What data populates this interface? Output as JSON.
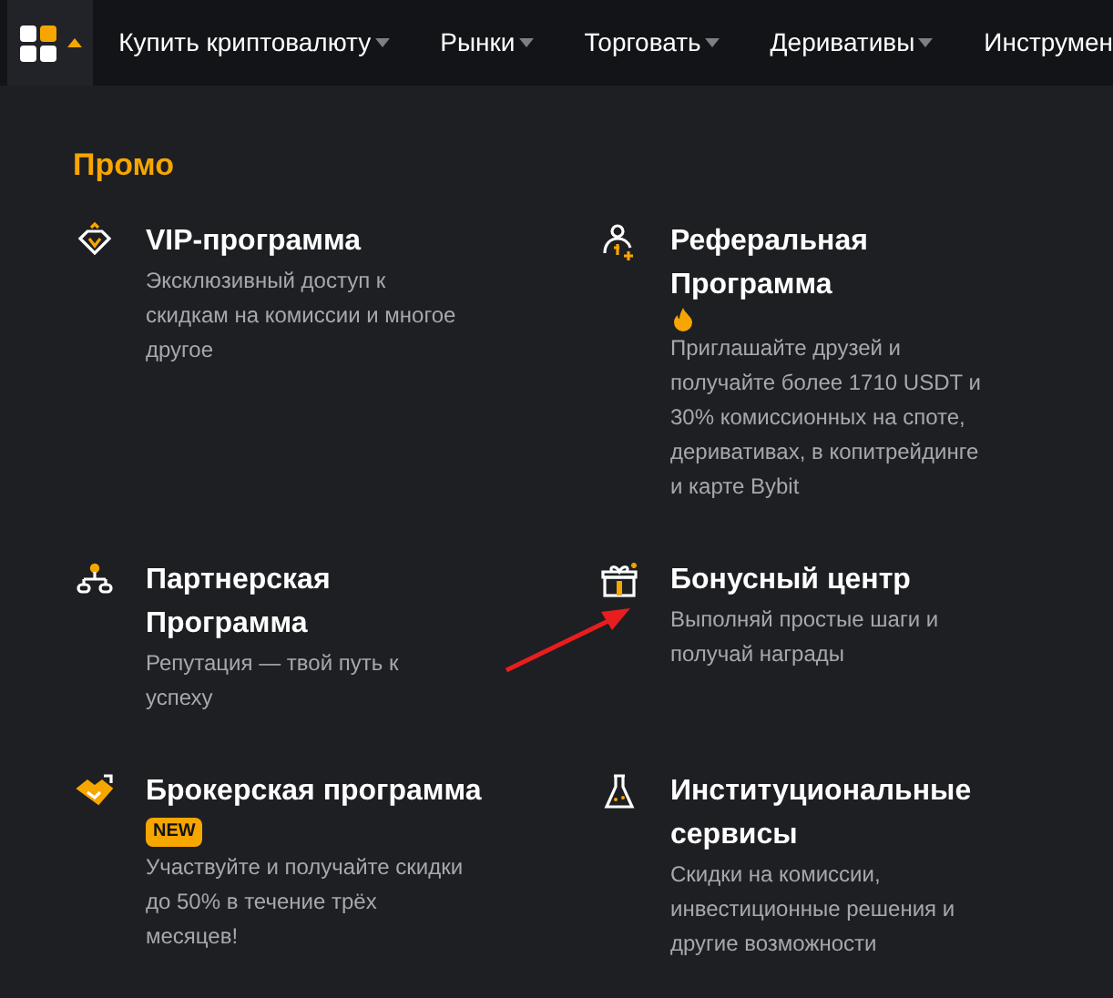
{
  "nav": {
    "menu_open": true,
    "items": [
      {
        "label": "Купить криптовалюту"
      },
      {
        "label": "Рынки"
      },
      {
        "label": "Торговать"
      },
      {
        "label": "Деривативы"
      },
      {
        "label": "Инструмен"
      }
    ]
  },
  "panel": {
    "title": "Промо",
    "items": [
      {
        "title": "VIP-программа",
        "description": "Эксклюзивный доступ к скидкам на комиссии и многое другое"
      },
      {
        "title": "Реферальная Программа",
        "hot": true,
        "description": "Приглашайте друзей и получайте более 1710 USDT и 30% комиссионных на споте, деривативах, в копитрейдинге и карте Bybit"
      },
      {
        "title": "Партнерская Программа",
        "description": "Репутация — твой путь к успеху"
      },
      {
        "title": "Бонусный центр",
        "description": "Выполняй простые шаги и получай награды"
      },
      {
        "title": "Брокерская программа",
        "badge": "NEW",
        "description": "Участвуйте и получайте скидки до 50% в течение трёх месяцев!"
      },
      {
        "title": "Институциональные сервисы",
        "description": "Скидки на комиссии, инвестиционные решения и другие возможности"
      }
    ]
  }
}
